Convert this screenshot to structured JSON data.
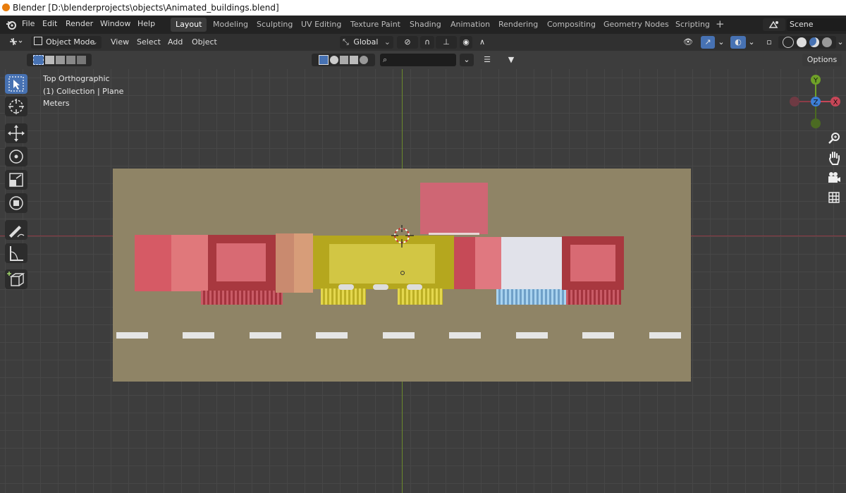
{
  "window": {
    "title": "Blender [D:\\blenderprojects\\objects\\Animated_buildings.blend]"
  },
  "menu": [
    "File",
    "Edit",
    "Render",
    "Window",
    "Help"
  ],
  "workspaces": [
    "Layout",
    "Modeling",
    "Sculpting",
    "UV Editing",
    "Texture Paint",
    "Shading",
    "Animation",
    "Rendering",
    "Compositing",
    "Geometry Nodes",
    "Scripting"
  ],
  "active_workspace": "Layout",
  "add_workspace_icon": "+",
  "scene": {
    "label": "Scene"
  },
  "header": {
    "mode": "Object Mode",
    "view": "View",
    "select": "Select",
    "add": "Add",
    "object": "Object",
    "orientation": "Global",
    "options": "Options"
  },
  "search": {
    "placeholder": ""
  },
  "viewport": {
    "view_name": "Top Orthographic",
    "collection": "(1) Collection | Plane",
    "units": "Meters"
  },
  "gizmo": {
    "y": "Y",
    "z": "Z",
    "x": "X"
  },
  "icons": {
    "tools": [
      "select-box-icon",
      "cursor-icon",
      "move-icon",
      "rotate-icon",
      "scale-icon",
      "transform-icon",
      "annotate-icon",
      "measure-icon",
      "add-cube-icon"
    ],
    "nav": [
      "zoom-icon",
      "hand-pan-icon",
      "camera-icon",
      "grid-icon"
    ]
  },
  "colors": {
    "accent": "#4772b3",
    "ground": "#8f8466",
    "red_building": "#c45964",
    "yellow_building": "#cdc13c",
    "white_building": "#dfe0ea",
    "axis_x": "#c64657",
    "axis_y": "#6fa128",
    "axis_z": "#3d7fd6"
  }
}
